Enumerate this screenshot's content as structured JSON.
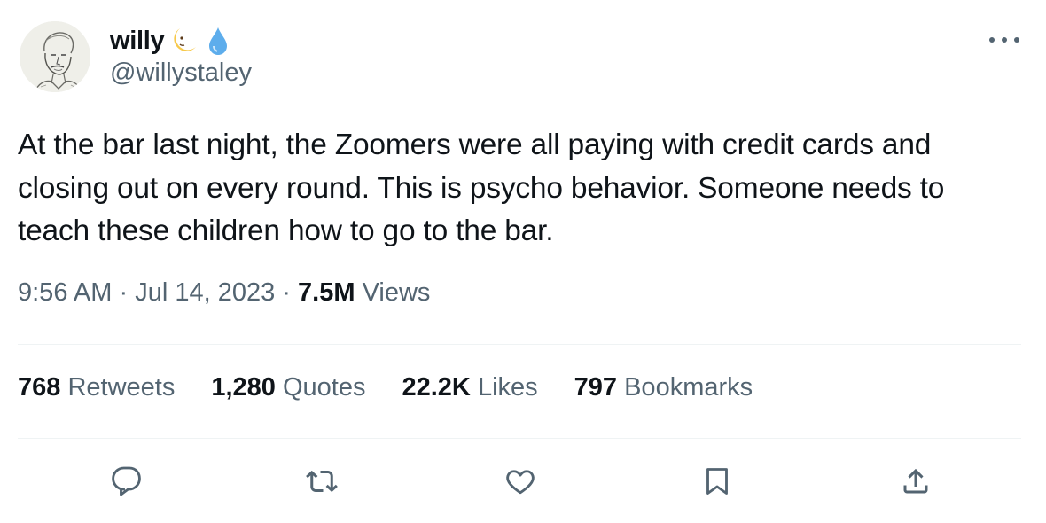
{
  "author": {
    "name": "willy",
    "handle": "@willystaley",
    "name_emojis": [
      "crescent-moon-face-icon",
      "droplet-icon"
    ]
  },
  "tweet": {
    "text": "At the bar last night, the Zoomers were all paying with credit cards and closing out on every round. This is psycho behavior. Someone needs to teach these children how to go to the bar.",
    "time": "9:56 AM",
    "separator": "·",
    "date": "Jul 14, 2023",
    "views_count": "7.5M",
    "views_label": "Views"
  },
  "stats": [
    {
      "count": "768",
      "label": "Retweets"
    },
    {
      "count": "1,280",
      "label": "Quotes"
    },
    {
      "count": "22.2K",
      "label": "Likes"
    },
    {
      "count": "797",
      "label": "Bookmarks"
    }
  ],
  "actions": [
    "reply-icon",
    "retweet-icon",
    "like-icon",
    "bookmark-icon",
    "share-icon"
  ],
  "colors": {
    "text_primary": "#0f1419",
    "text_secondary": "#536471",
    "divider": "#eff3f4",
    "moon": "#f7c94b",
    "droplet": "#5dadec"
  }
}
